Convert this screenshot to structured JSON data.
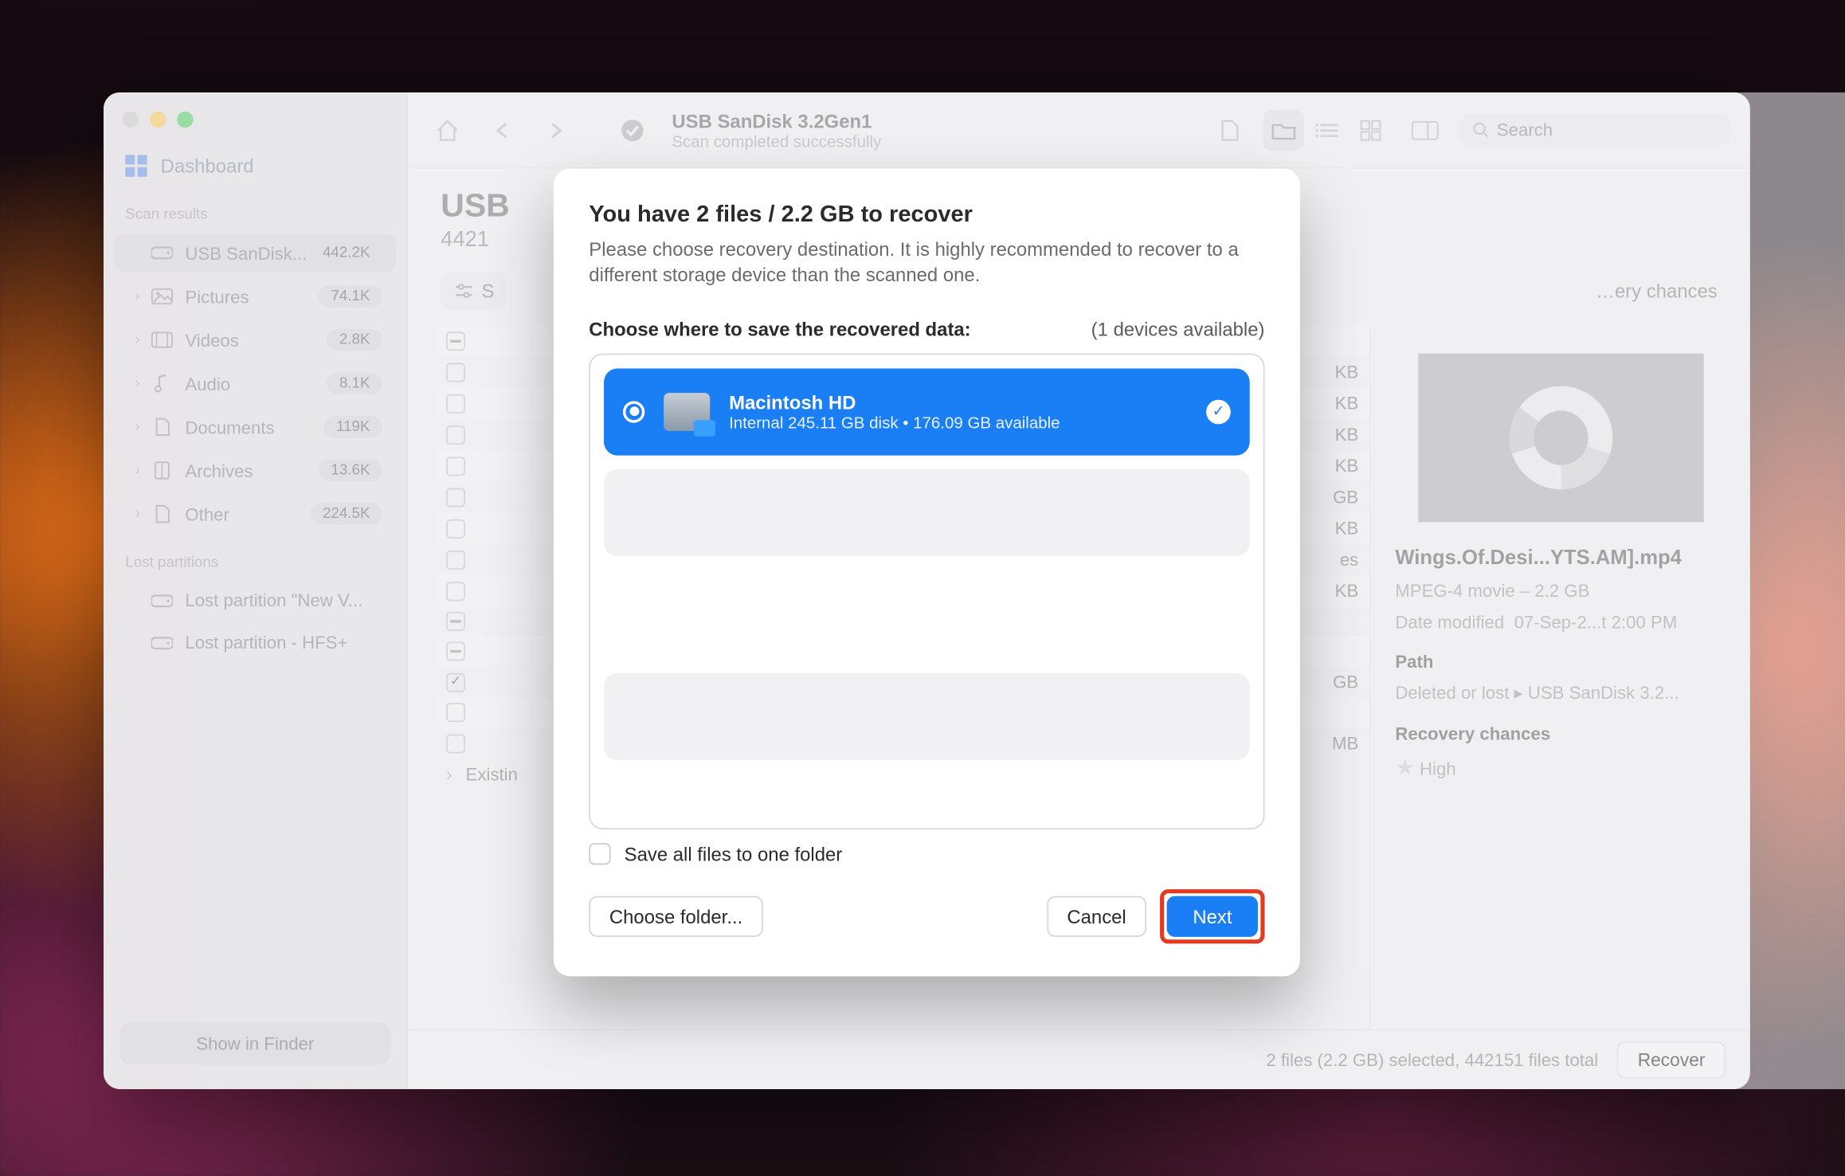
{
  "toolbar": {
    "title": "USB  SanDisk 3.2Gen1",
    "subtitle": "Scan completed successfully",
    "search_placeholder": "Search"
  },
  "sidebar": {
    "dashboard_label": "Dashboard",
    "sections": {
      "scan_results": "Scan results",
      "lost_partitions": "Lost partitions"
    },
    "items": [
      {
        "label": "USB  SanDisk...",
        "badge": "442.2K"
      },
      {
        "label": "Pictures",
        "badge": "74.1K"
      },
      {
        "label": "Videos",
        "badge": "2.8K"
      },
      {
        "label": "Audio",
        "badge": "8.1K"
      },
      {
        "label": "Documents",
        "badge": "119K"
      },
      {
        "label": "Archives",
        "badge": "13.6K"
      },
      {
        "label": "Other",
        "badge": "224.5K"
      }
    ],
    "lost": [
      {
        "label": "Lost partition \"New V..."
      },
      {
        "label": "Lost partition - HFS+"
      }
    ],
    "show_in_finder": "Show in Finder"
  },
  "mainHeader": {
    "big": "USB",
    "sub": "4421"
  },
  "toolRow": {
    "filter_label": "S",
    "dropdown_label": "…ery chances"
  },
  "table": {
    "size_header": "",
    "rows": [
      {
        "chk": "dash",
        "size": ""
      },
      {
        "chk": "none",
        "size": "KB"
      },
      {
        "chk": "none",
        "size": "KB"
      },
      {
        "chk": "none",
        "size": "KB"
      },
      {
        "chk": "none",
        "size": "KB"
      },
      {
        "chk": "none",
        "size": "GB"
      },
      {
        "chk": "none",
        "size": "KB"
      },
      {
        "chk": "none",
        "size": "es"
      },
      {
        "chk": "none",
        "size": "KB"
      },
      {
        "chk": "dash",
        "size": ""
      },
      {
        "chk": "dash",
        "size": ""
      },
      {
        "chk": "check",
        "size": "GB"
      },
      {
        "chk": "none",
        "size": ""
      },
      {
        "chk": "none",
        "size": "MB"
      }
    ],
    "existing_label": "Existin"
  },
  "preview": {
    "filename": "Wings.Of.Desi...YTS.AM].mp4",
    "type_line": "MPEG-4 movie – 2.2 GB",
    "date_label": "Date modified",
    "date_value": "07-Sep-2...t 2:00 PM",
    "path_label": "Path",
    "path_value": "Deleted or lost ▸ USB  SanDisk 3.2...",
    "chances_label": "Recovery chances",
    "chances_value": "High"
  },
  "footer": {
    "summary": "2 files (2.2 GB) selected, 442151 files total",
    "recover": "Recover"
  },
  "modal": {
    "title": "You have 2 files / 2.2 GB to recover",
    "desc": "Please choose recovery destination. It is highly recommended to recover to a different storage device than the scanned one.",
    "choose_label": "Choose where to save the recovered data:",
    "devices_label": "(1 devices available)",
    "destination": {
      "name": "Macintosh HD",
      "meta": "Internal 245.11 GB disk • 176.09 GB available"
    },
    "save_one_folder": "Save all files to one folder",
    "choose_folder": "Choose folder...",
    "cancel": "Cancel",
    "next": "Next"
  }
}
